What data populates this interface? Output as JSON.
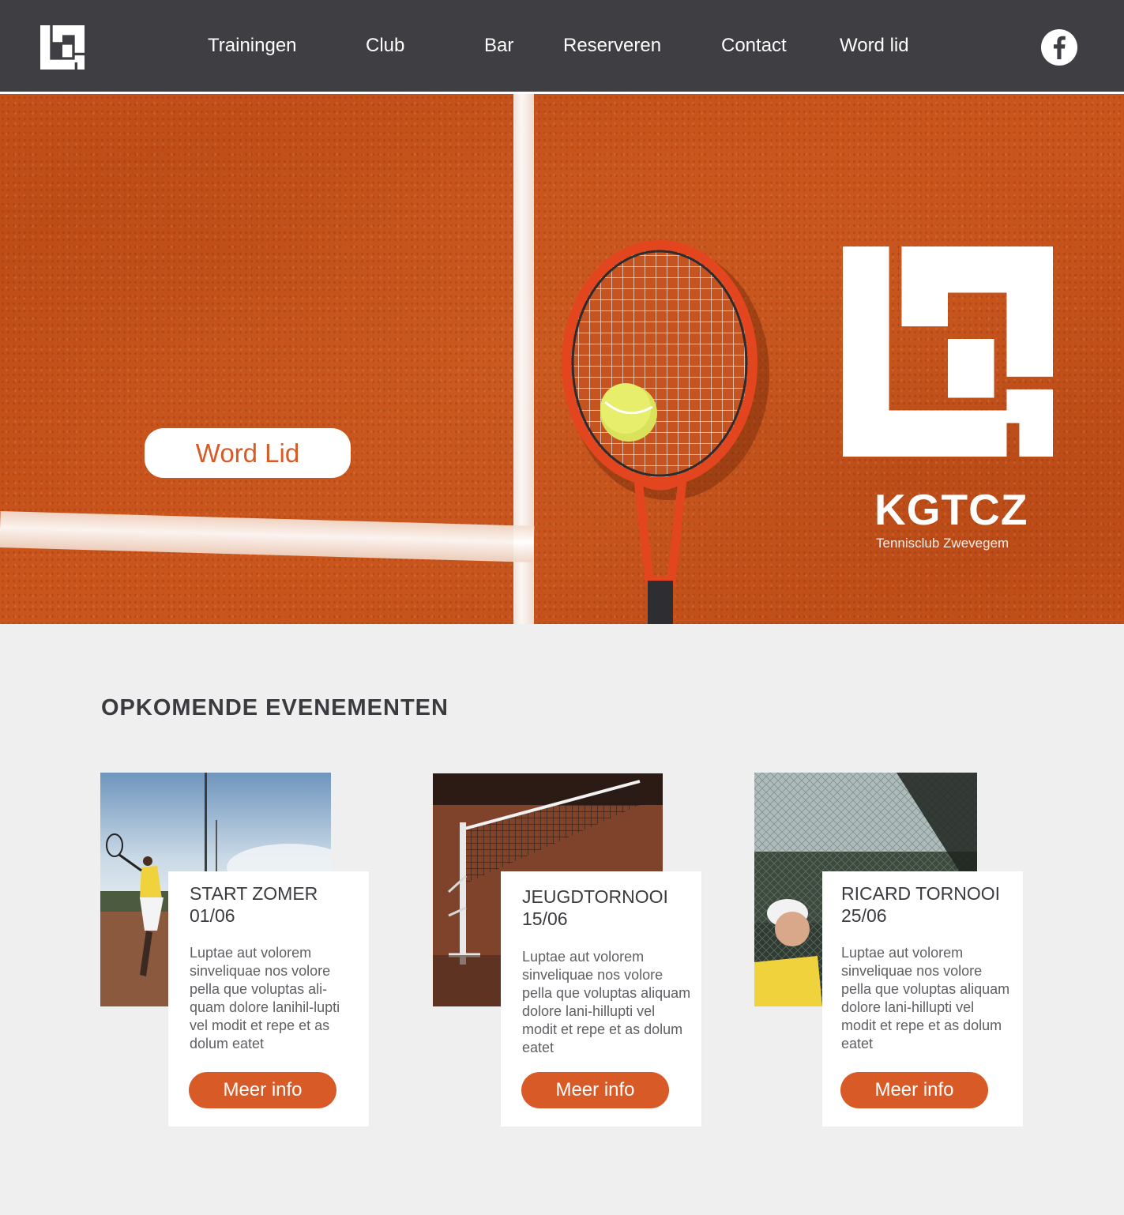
{
  "nav": {
    "items": [
      {
        "label": "Trainingen"
      },
      {
        "label": "Club"
      },
      {
        "label": "Bar"
      },
      {
        "label": "Reserveren"
      },
      {
        "label": "Contact"
      },
      {
        "label": "Word lid"
      }
    ],
    "logo_icon": "club-logo-icon",
    "social_icon": "facebook-icon"
  },
  "hero": {
    "cta_label": "Word Lid",
    "brand_name": "KGTCZ",
    "brand_subtitle": "Tennisclub Zwevegem"
  },
  "events": {
    "title": "OPKOMENDE EVENEMENTEN",
    "items": [
      {
        "title": "START ZOMER",
        "date": "01/06",
        "text": "Luptae aut volorem sinveliquae nos volore pella que voluptas ali-quam dolore lanihil-lupti vel modit et repe et as dolum eatet",
        "button_label": "Meer info"
      },
      {
        "title": "JEUGDTORNOOI",
        "date": "15/06",
        "text": "Luptae aut volorem sinveliquae nos volore pella que voluptas aliquam dolore lani-hillupti vel modit et repe et as dolum eatet",
        "button_label": "Meer info"
      },
      {
        "title": "RICARD TORNOOI",
        "date": "25/06",
        "text": "Luptae aut volorem sinveliquae nos volore pella que voluptas aliquam dolore lani-hillupti vel modit et repe et as dolum eatet",
        "button_label": "Meer info"
      }
    ]
  },
  "colors": {
    "header_bg": "#3e3e43",
    "accent": "#d85a27",
    "page_bg": "#efefef",
    "clay": "#d45f24"
  }
}
